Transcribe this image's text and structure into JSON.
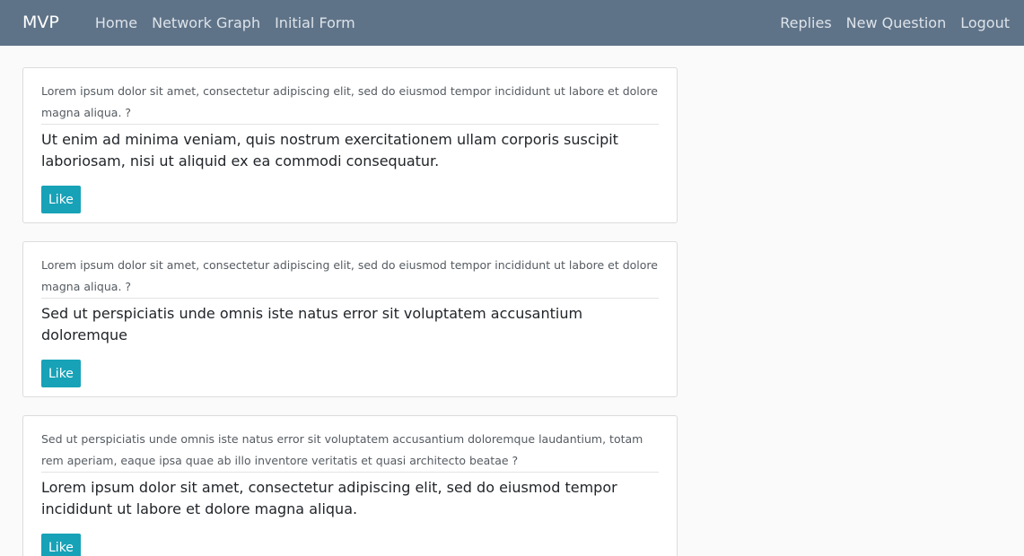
{
  "navbar": {
    "brand": "MVP",
    "left_links": [
      "Home",
      "Network Graph",
      "Initial Form"
    ],
    "right_links": [
      "Replies",
      "New Question",
      "Logout"
    ],
    "background_color": "#5f7388"
  },
  "feed": {
    "cards": [
      {
        "question": "Lorem ipsum dolor sit amet, consectetur adipiscing elit, sed do eiusmod tempor incididunt ut labore et dolore magna aliqua. ?",
        "answer": "Ut enim ad minima veniam, quis nostrum exercitationem ullam corporis suscipit laboriosam, nisi ut aliquid ex ea commodi consequatur.",
        "like_label": "Like"
      },
      {
        "question": "Lorem ipsum dolor sit amet, consectetur adipiscing elit, sed do eiusmod tempor incididunt ut labore et dolore magna aliqua. ?",
        "answer": "Sed ut perspiciatis unde omnis iste natus error sit voluptatem accusantium doloremque",
        "like_label": "Like"
      },
      {
        "question": "Sed ut perspiciatis unde omnis iste natus error sit voluptatem accusantium doloremque laudantium, totam rem aperiam, eaque ipsa quae ab illo inventore veritatis et quasi architecto beatae ?",
        "answer": "Lorem ipsum dolor sit amet, consectetur adipiscing elit, sed do eiusmod tempor incididunt ut labore et dolore magna aliqua.",
        "like_label": "Like"
      }
    ],
    "like_button_color": "#17a2b8"
  }
}
